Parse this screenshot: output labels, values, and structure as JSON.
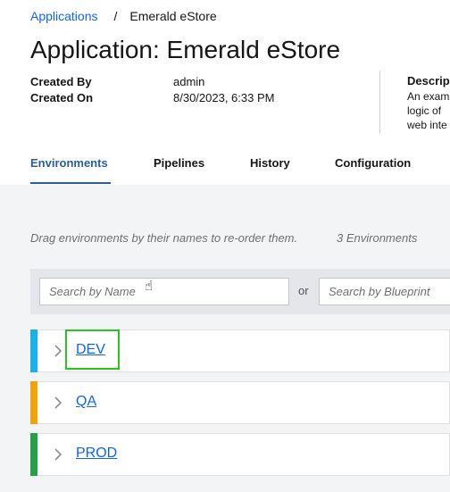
{
  "breadcrumb": {
    "parent": "Applications",
    "separator": "/",
    "current": "Emerald eStore"
  },
  "page_title": "Application: Emerald eStore",
  "meta": {
    "created_by_label": "Created By",
    "created_by_value": "admin",
    "created_on_label": "Created On",
    "created_on_value": "8/30/2023, 6:33 PM"
  },
  "description": {
    "label": "Descrip",
    "lines": [
      "An exam",
      "logic of",
      "web inte"
    ]
  },
  "tabs": [
    {
      "label": "Environments",
      "active": true
    },
    {
      "label": "Pipelines",
      "active": false
    },
    {
      "label": "History",
      "active": false
    },
    {
      "label": "Configuration",
      "active": false
    }
  ],
  "environments_section": {
    "hint": "Drag environments by their names to re-order them.",
    "count": "3 Environments",
    "search_name_placeholder": "Search by Name",
    "or_text": "or",
    "search_blueprint_placeholder": "Search by Blueprint"
  },
  "environments": [
    {
      "name": "DEV",
      "color": "#1ab0e8"
    },
    {
      "name": "QA",
      "color": "#f0a30a"
    },
    {
      "name": "PROD",
      "color": "#24a148"
    }
  ],
  "colors": {
    "link": "#0f62fe",
    "active_tab": "#2a5f9a",
    "focus_outline": "#2ac51f"
  }
}
